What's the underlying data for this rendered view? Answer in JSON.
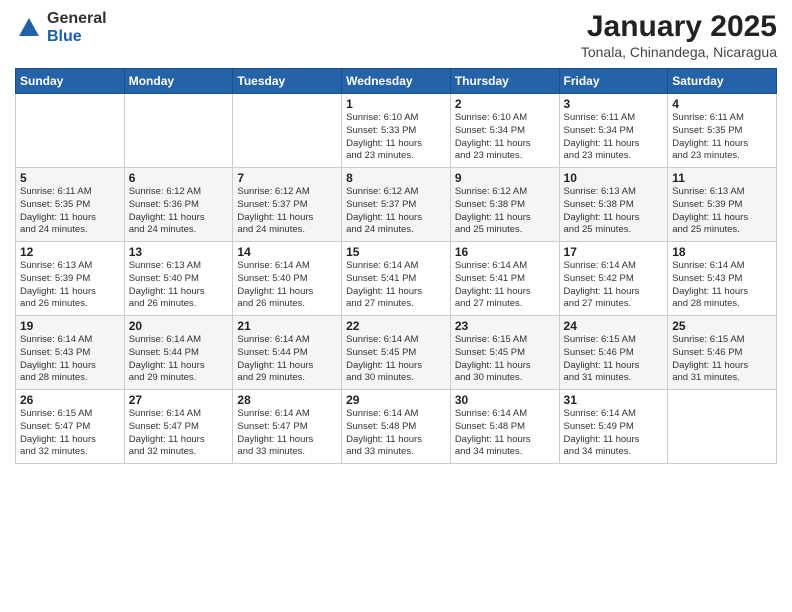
{
  "header": {
    "logo_general": "General",
    "logo_blue": "Blue",
    "month_title": "January 2025",
    "location": "Tonala, Chinandega, Nicaragua"
  },
  "days_of_week": [
    "Sunday",
    "Monday",
    "Tuesday",
    "Wednesday",
    "Thursday",
    "Friday",
    "Saturday"
  ],
  "weeks": [
    [
      {
        "day": "",
        "info": ""
      },
      {
        "day": "",
        "info": ""
      },
      {
        "day": "",
        "info": ""
      },
      {
        "day": "1",
        "info": "Sunrise: 6:10 AM\nSunset: 5:33 PM\nDaylight: 11 hours\nand 23 minutes."
      },
      {
        "day": "2",
        "info": "Sunrise: 6:10 AM\nSunset: 5:34 PM\nDaylight: 11 hours\nand 23 minutes."
      },
      {
        "day": "3",
        "info": "Sunrise: 6:11 AM\nSunset: 5:34 PM\nDaylight: 11 hours\nand 23 minutes."
      },
      {
        "day": "4",
        "info": "Sunrise: 6:11 AM\nSunset: 5:35 PM\nDaylight: 11 hours\nand 23 minutes."
      }
    ],
    [
      {
        "day": "5",
        "info": "Sunrise: 6:11 AM\nSunset: 5:35 PM\nDaylight: 11 hours\nand 24 minutes."
      },
      {
        "day": "6",
        "info": "Sunrise: 6:12 AM\nSunset: 5:36 PM\nDaylight: 11 hours\nand 24 minutes."
      },
      {
        "day": "7",
        "info": "Sunrise: 6:12 AM\nSunset: 5:37 PM\nDaylight: 11 hours\nand 24 minutes."
      },
      {
        "day": "8",
        "info": "Sunrise: 6:12 AM\nSunset: 5:37 PM\nDaylight: 11 hours\nand 24 minutes."
      },
      {
        "day": "9",
        "info": "Sunrise: 6:12 AM\nSunset: 5:38 PM\nDaylight: 11 hours\nand 25 minutes."
      },
      {
        "day": "10",
        "info": "Sunrise: 6:13 AM\nSunset: 5:38 PM\nDaylight: 11 hours\nand 25 minutes."
      },
      {
        "day": "11",
        "info": "Sunrise: 6:13 AM\nSunset: 5:39 PM\nDaylight: 11 hours\nand 25 minutes."
      }
    ],
    [
      {
        "day": "12",
        "info": "Sunrise: 6:13 AM\nSunset: 5:39 PM\nDaylight: 11 hours\nand 26 minutes."
      },
      {
        "day": "13",
        "info": "Sunrise: 6:13 AM\nSunset: 5:40 PM\nDaylight: 11 hours\nand 26 minutes."
      },
      {
        "day": "14",
        "info": "Sunrise: 6:14 AM\nSunset: 5:40 PM\nDaylight: 11 hours\nand 26 minutes."
      },
      {
        "day": "15",
        "info": "Sunrise: 6:14 AM\nSunset: 5:41 PM\nDaylight: 11 hours\nand 27 minutes."
      },
      {
        "day": "16",
        "info": "Sunrise: 6:14 AM\nSunset: 5:41 PM\nDaylight: 11 hours\nand 27 minutes."
      },
      {
        "day": "17",
        "info": "Sunrise: 6:14 AM\nSunset: 5:42 PM\nDaylight: 11 hours\nand 27 minutes."
      },
      {
        "day": "18",
        "info": "Sunrise: 6:14 AM\nSunset: 5:43 PM\nDaylight: 11 hours\nand 28 minutes."
      }
    ],
    [
      {
        "day": "19",
        "info": "Sunrise: 6:14 AM\nSunset: 5:43 PM\nDaylight: 11 hours\nand 28 minutes."
      },
      {
        "day": "20",
        "info": "Sunrise: 6:14 AM\nSunset: 5:44 PM\nDaylight: 11 hours\nand 29 minutes."
      },
      {
        "day": "21",
        "info": "Sunrise: 6:14 AM\nSunset: 5:44 PM\nDaylight: 11 hours\nand 29 minutes."
      },
      {
        "day": "22",
        "info": "Sunrise: 6:14 AM\nSunset: 5:45 PM\nDaylight: 11 hours\nand 30 minutes."
      },
      {
        "day": "23",
        "info": "Sunrise: 6:15 AM\nSunset: 5:45 PM\nDaylight: 11 hours\nand 30 minutes."
      },
      {
        "day": "24",
        "info": "Sunrise: 6:15 AM\nSunset: 5:46 PM\nDaylight: 11 hours\nand 31 minutes."
      },
      {
        "day": "25",
        "info": "Sunrise: 6:15 AM\nSunset: 5:46 PM\nDaylight: 11 hours\nand 31 minutes."
      }
    ],
    [
      {
        "day": "26",
        "info": "Sunrise: 6:15 AM\nSunset: 5:47 PM\nDaylight: 11 hours\nand 32 minutes."
      },
      {
        "day": "27",
        "info": "Sunrise: 6:14 AM\nSunset: 5:47 PM\nDaylight: 11 hours\nand 32 minutes."
      },
      {
        "day": "28",
        "info": "Sunrise: 6:14 AM\nSunset: 5:47 PM\nDaylight: 11 hours\nand 33 minutes."
      },
      {
        "day": "29",
        "info": "Sunrise: 6:14 AM\nSunset: 5:48 PM\nDaylight: 11 hours\nand 33 minutes."
      },
      {
        "day": "30",
        "info": "Sunrise: 6:14 AM\nSunset: 5:48 PM\nDaylight: 11 hours\nand 34 minutes."
      },
      {
        "day": "31",
        "info": "Sunrise: 6:14 AM\nSunset: 5:49 PM\nDaylight: 11 hours\nand 34 minutes."
      },
      {
        "day": "",
        "info": ""
      }
    ]
  ]
}
